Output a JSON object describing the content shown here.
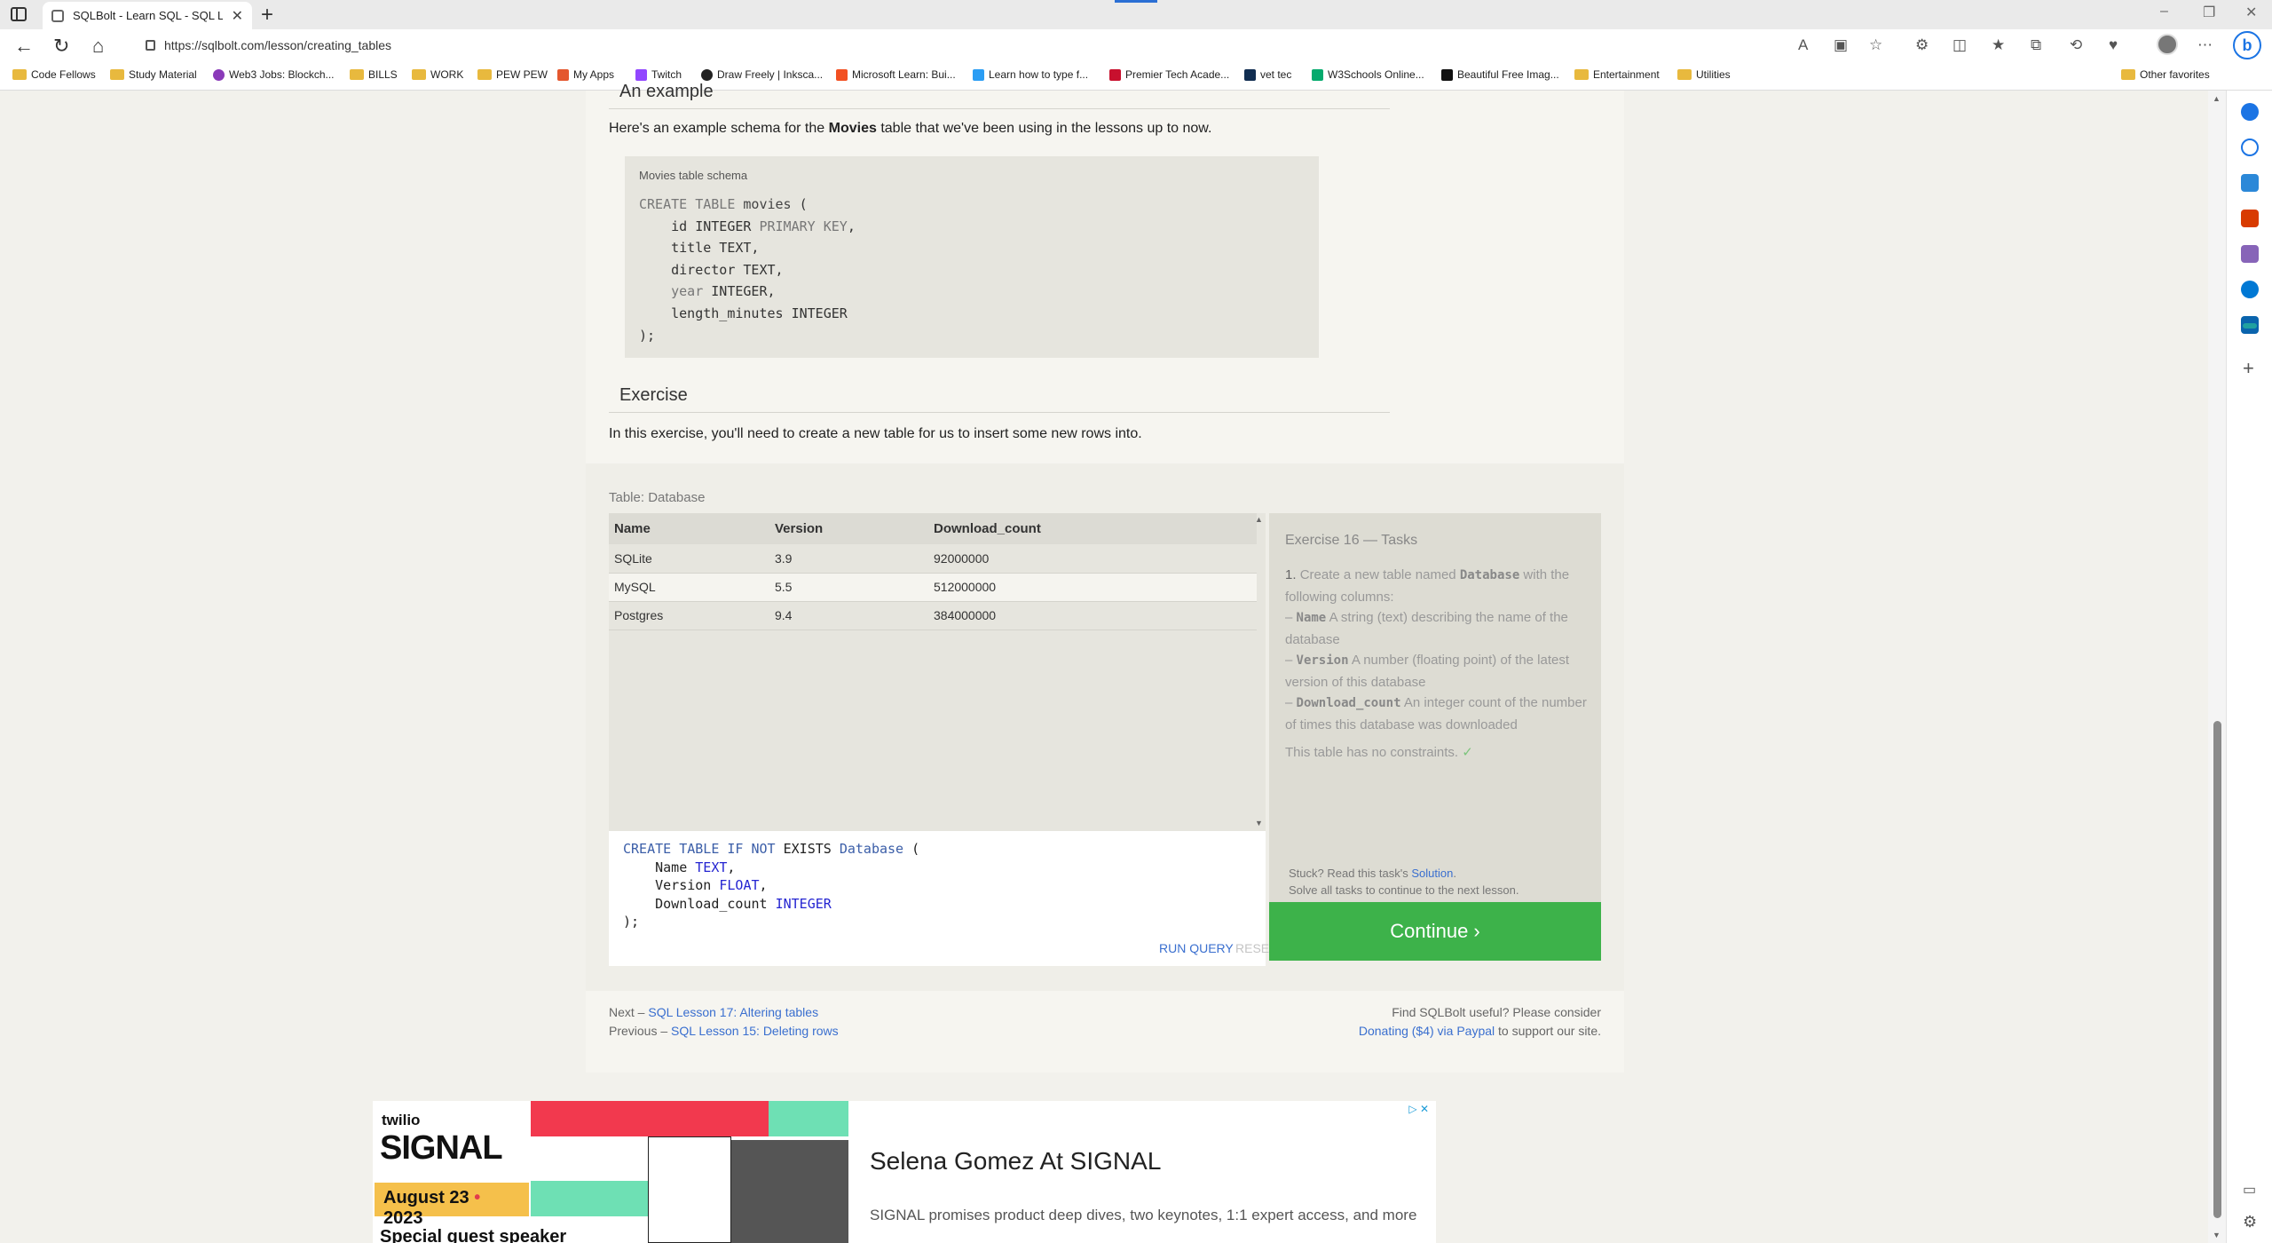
{
  "browser": {
    "tab_title": "SQLBolt - Learn SQL - SQL Lesson",
    "url": "https://sqlbolt.com/lesson/creating_tables"
  },
  "bookmarks": [
    {
      "label": "Code Fellows",
      "icon": "folder-icon"
    },
    {
      "label": "Study Material",
      "icon": "folder-icon"
    },
    {
      "label": "Web3 Jobs: Blockch...",
      "icon": "web3-icon"
    },
    {
      "label": "BILLS",
      "icon": "folder-icon"
    },
    {
      "label": "WORK",
      "icon": "folder-icon"
    },
    {
      "label": "PEW PEW",
      "icon": "folder-icon"
    },
    {
      "label": "My Apps",
      "icon": "microsoft-icon"
    },
    {
      "label": "Twitch",
      "icon": "twitch-icon"
    },
    {
      "label": "Draw Freely | Inksca...",
      "icon": "inkscape-icon"
    },
    {
      "label": "Microsoft Learn: Bui...",
      "icon": "microsoft-icon"
    },
    {
      "label": "Learn how to type f...",
      "icon": "typing-icon"
    },
    {
      "label": "Premier Tech Acade...",
      "icon": "shield-icon"
    },
    {
      "label": "vet tec",
      "icon": "va-icon"
    },
    {
      "label": "W3Schools Online...",
      "icon": "w3schools-icon"
    },
    {
      "label": "Beautiful Free Imag...",
      "icon": "unsplash-icon"
    },
    {
      "label": "Entertainment",
      "icon": "folder-icon"
    },
    {
      "label": "Utilities",
      "icon": "folder-icon"
    }
  ],
  "other_favorites": "Other favorites",
  "lesson": {
    "example_heading": "An example",
    "example_intro_pre": "Here's an example schema for the ",
    "example_intro_bold": "Movies",
    "example_intro_post": " table that we've been using in the lessons up to now.",
    "schema_caption": "Movies table schema",
    "exercise_heading": "Exercise",
    "exercise_intro": "In this exercise, you'll need to create a new table for us to insert some new rows into."
  },
  "db_table": {
    "label": "Table: Database",
    "headers": [
      "Name",
      "Version",
      "Download_count"
    ],
    "rows": [
      [
        "SQLite",
        "3.9",
        "92000000"
      ],
      [
        "MySQL",
        "5.5",
        "512000000"
      ],
      [
        "Postgres",
        "9.4",
        "384000000"
      ]
    ]
  },
  "editor": {
    "run_label": "RUN QUERY",
    "reset_label": "RESET"
  },
  "tasks": {
    "title": "Exercise 16 — Tasks",
    "task_num": "1.",
    "task_text_pre": "Create a new table named ",
    "task_table_name": "Database",
    "task_text_post": " with the following columns:",
    "columns": [
      {
        "name": "Name",
        "desc": "A string (text) describing the name of the database"
      },
      {
        "name": "Version",
        "desc": "A number (floating point) of the latest version of this database"
      },
      {
        "name": "Download_count",
        "desc": "An integer count of the number of times this database was downloaded"
      }
    ],
    "constraints": "This table has no constraints.",
    "stuck_pre": "Stuck? Read this task's ",
    "stuck_link": "Solution",
    "stuck_line2": "Solve all tasks to continue to the next lesson.",
    "continue_label": "Continue ›"
  },
  "footer": {
    "next_prefix": "Next – ",
    "next_link": "SQL Lesson 17: Altering tables",
    "prev_prefix": "Previous – ",
    "prev_link": "SQL Lesson 15: Deleting rows",
    "donate_line1": "Find SQLBolt useful? Please consider",
    "donate_link": "Donating ($4) via Paypal",
    "donate_post": " to support our site."
  },
  "ad": {
    "brand": "twilio",
    "event": "SIGNAL",
    "date_pre": "August 23",
    "date_post": "2023",
    "special": "Special guest speaker",
    "headline": "Selena Gomez At SIGNAL",
    "text": "SIGNAL promises product deep dives, two keynotes, 1:1 expert access, and more"
  },
  "colors": {
    "continue_green": "#3db24a",
    "link_blue": "#3a6fcf",
    "accent": "#2b6fd4"
  }
}
